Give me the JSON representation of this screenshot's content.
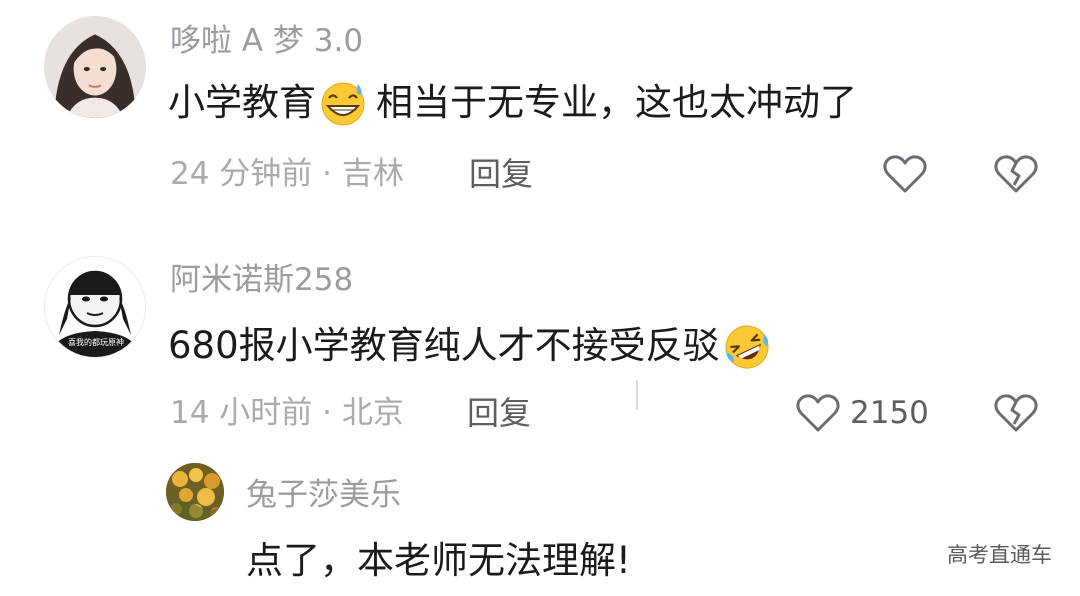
{
  "comments": [
    {
      "username": "哆啦 A 梦 3.0",
      "text_before": "小学教育",
      "emoji": "grinning-sweat-emoji",
      "text_after": "相当于无专业，这也太冲动了",
      "time_location": "24 分钟前 · 吉林",
      "reply_label": "回复"
    },
    {
      "username": "阿米诺斯258",
      "text_before": "680报小学教育纯人才不接受反驳",
      "emoji": "rolling-laughing-emoji",
      "text_after": "",
      "time_location": "14 小时前 · 北京",
      "reply_label": "回复",
      "like_count": "2150",
      "avatar_caption": "喜我的都玩原神"
    }
  ],
  "sub_reply": {
    "username": "兔子莎美乐",
    "text": "点了，本老师无法理解!"
  },
  "watermark": "高考直通车",
  "icons": {
    "like": "heart-outline-icon",
    "dislike": "broken-heart-icon"
  }
}
